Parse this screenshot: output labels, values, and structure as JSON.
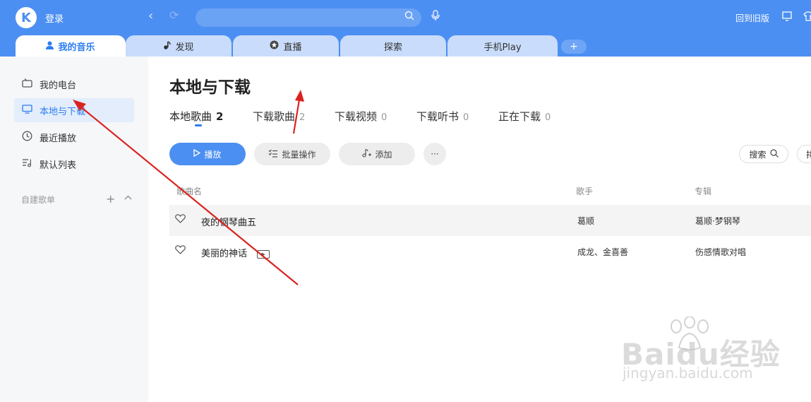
{
  "header": {
    "logo_letter": "K",
    "login_label": "登录",
    "back_icon": "‹",
    "refresh_icon": "⟳",
    "search_placeholder": "",
    "old_version_label": "回到旧版"
  },
  "tabs": [
    {
      "label": "我的音乐",
      "icon": "person-icon",
      "active": true
    },
    {
      "label": "发现",
      "icon": "music-note-icon",
      "active": false
    },
    {
      "label": "直播",
      "icon": "star-circle-icon",
      "active": false
    },
    {
      "label": "探索",
      "icon": "",
      "active": false
    },
    {
      "label": "手机Play",
      "icon": "",
      "active": false
    }
  ],
  "tab_add_label": "+",
  "sidebar": {
    "items": [
      {
        "label": "我的电台",
        "icon": "radio-icon",
        "active": false
      },
      {
        "label": "本地与下载",
        "icon": "monitor-icon",
        "active": true
      },
      {
        "label": "最近播放",
        "icon": "clock-icon",
        "active": false
      },
      {
        "label": "默认列表",
        "icon": "playlist-icon",
        "active": false
      }
    ],
    "group_label": "自建歌单",
    "group_add": "+",
    "group_collapse": "^"
  },
  "main": {
    "title": "本地与下载",
    "sub_tabs": [
      {
        "label": "本地歌曲",
        "count": "2",
        "active": true
      },
      {
        "label": "下载歌曲",
        "count": "2",
        "active": false
      },
      {
        "label": "下载视频",
        "count": "0",
        "active": false
      },
      {
        "label": "下载听书",
        "count": "0",
        "active": false
      },
      {
        "label": "正在下载",
        "count": "0",
        "active": false
      }
    ],
    "buttons": {
      "play": "播放",
      "batch": "批量操作",
      "add": "添加",
      "more": "···",
      "search": "搜索",
      "sort": "排"
    },
    "columns": {
      "song": "歌曲名",
      "artist": "歌手",
      "album": "专辑"
    },
    "rows": [
      {
        "title": "夜的钢琴曲五",
        "artist": "葛顺",
        "album": "葛顺·梦钢琴",
        "has_mv": false
      },
      {
        "title": "美丽的神话",
        "artist": "成龙、金喜善",
        "album": "伤感情歌对唱",
        "has_mv": true
      }
    ]
  },
  "watermark": {
    "brand": "Baidu经验",
    "url": "jingyan.baidu.com"
  },
  "colors": {
    "accent": "#4c8ff2",
    "annotation_arrow": "#d9231f"
  }
}
